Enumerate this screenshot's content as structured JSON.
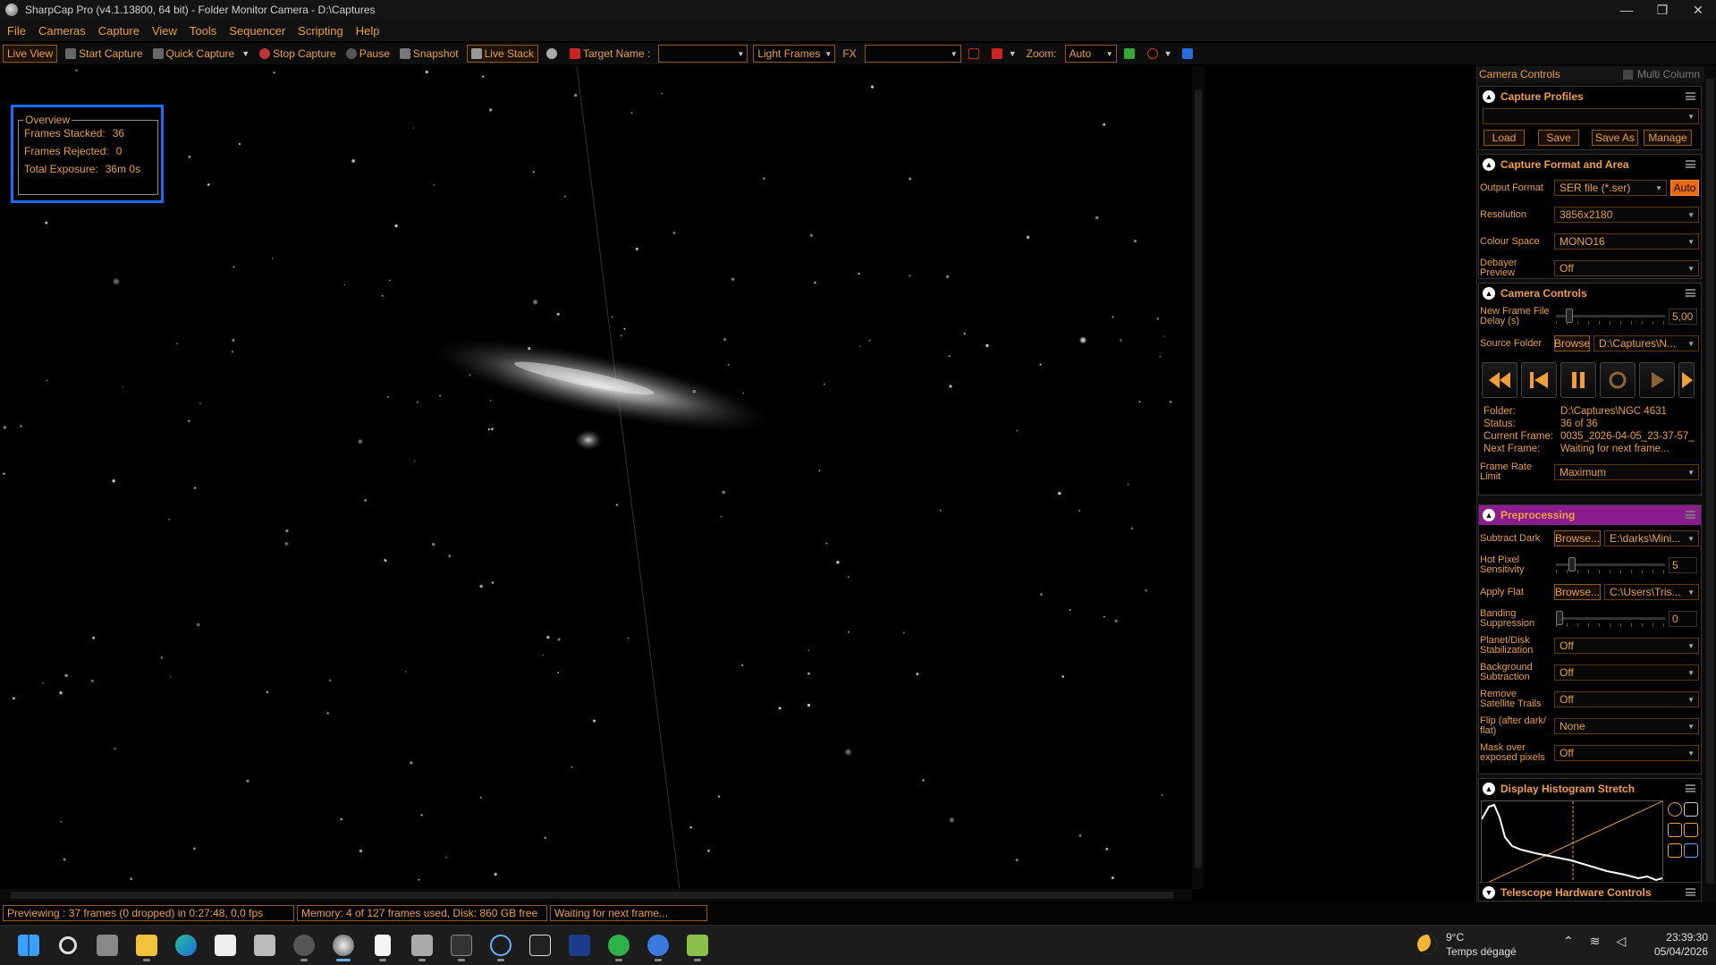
{
  "window": {
    "title": "SharpCap Pro (v4.1.13800, 64 bit) - Folder Monitor Camera - D:\\Captures",
    "minimize": "—",
    "restore": "❐",
    "close": "✕"
  },
  "menu": [
    "File",
    "Cameras",
    "Capture",
    "View",
    "Tools",
    "Sequencer",
    "Scripting",
    "Help"
  ],
  "toolbar": {
    "live_view": "Live View",
    "start_capture": "Start Capture",
    "quick_capture": "Quick Capture",
    "stop_capture": "Stop Capture",
    "pause": "Pause",
    "snapshot": "Snapshot",
    "live_stack": "Live Stack",
    "target_name_label": "Target Name :",
    "target_name_value": "",
    "frame_type": "Light Frames",
    "fx_label": "FX",
    "fx_value": "",
    "zoom_label": "Zoom:",
    "zoom_value": "Auto"
  },
  "overview": {
    "title": "Overview",
    "frames_stacked_label": "Frames Stacked:",
    "frames_stacked": "36",
    "frames_rejected_label": "Frames Rejected:",
    "frames_rejected": "0",
    "total_exposure_label": "Total Exposure:",
    "total_exposure": "36m 0s"
  },
  "panel": {
    "header": "Camera Controls",
    "multi_column": "Multi Column",
    "capture_profiles": {
      "title": "Capture Profiles",
      "selected": "",
      "load": "Load",
      "save": "Save",
      "save_as": "Save As",
      "manage": "Manage"
    },
    "capture_format": {
      "title": "Capture Format and Area",
      "output_format_label": "Output Format",
      "output_format": "SER file (*.ser)",
      "auto": "Auto",
      "resolution_label": "Resolution",
      "resolution": "3856x2180",
      "colour_space_label": "Colour Space",
      "colour_space": "MONO16",
      "debayer_label": "Debayer Preview",
      "debayer": "Off"
    },
    "camera_controls": {
      "title": "Camera Controls",
      "new_frame_delay_label": "New Frame File Delay (s)",
      "new_frame_delay": "5,00",
      "new_frame_delay_level": 0.1,
      "source_folder_label": "Source Folder",
      "browse": "Browse",
      "source_folder": "D:\\Captures\\N...",
      "info": [
        {
          "k": "Folder:",
          "v": "D:\\Captures\\NGC 4631"
        },
        {
          "k": "Status:",
          "v": "36 of 36"
        },
        {
          "k": "Current Frame:",
          "v": "0035_2026-04-05_23-37-57_"
        },
        {
          "k": "Next Frame:",
          "v": "Waiting for next frame..."
        }
      ],
      "frame_rate_label": "Frame Rate Limit",
      "frame_rate": "Maximum"
    },
    "preprocessing": {
      "title": "Preprocessing",
      "subtract_dark_label": "Subtract Dark",
      "browse": "Browse...",
      "subtract_dark": "E:\\darks\\Mini...",
      "hot_pixel_label": "Hot Pixel Sensitivity",
      "hot_pixel": "5",
      "hot_pixel_level": 0.12,
      "apply_flat_label": "Apply Flat",
      "apply_flat": "C:\\Users\\Tris...",
      "banding_label": "Banding Suppression",
      "banding": "0",
      "banding_level": 0.0,
      "stabilization_label": "Planet/Disk Stabilization",
      "stabilization": "Off",
      "background_label": "Background Subtraction",
      "background": "Off",
      "satellite_label": "Remove Satellite Trails",
      "satellite": "Off",
      "flip_label": "Flip (after dark/ flat)",
      "flip": "None",
      "mask_label": "Mask over exposed pixels",
      "mask": "Off"
    },
    "histogram": {
      "title": "Display Histogram Stretch"
    },
    "telescope": {
      "title": "Telescope Hardware Controls"
    }
  },
  "status": {
    "preview": "Previewing : 37 frames (0 dropped) in 0:27:48, 0,0 fps",
    "memory": "Memory: 4 of 127 frames used, Disk: 860 GB free",
    "waiting": "Waiting for next frame..."
  },
  "taskbar": {
    "apps": [
      "windows-start",
      "search",
      "task-view",
      "file-explorer",
      "edge",
      "store",
      "printer",
      "app-stellarium",
      "app-sharpcap",
      "notepad",
      "app-pen",
      "terminal",
      "app-galaxy",
      "app-asi",
      "app-astap",
      "app-green",
      "app-blue",
      "app-notes"
    ],
    "weather_temp": "9°C",
    "weather_desc": "Temps dégagé",
    "time": "23:39:30",
    "date": "05/04/2026"
  },
  "colors": {
    "accent": "#e8a040",
    "highlight": "#1a6cff",
    "preprocessing": "#8a1c8e"
  }
}
